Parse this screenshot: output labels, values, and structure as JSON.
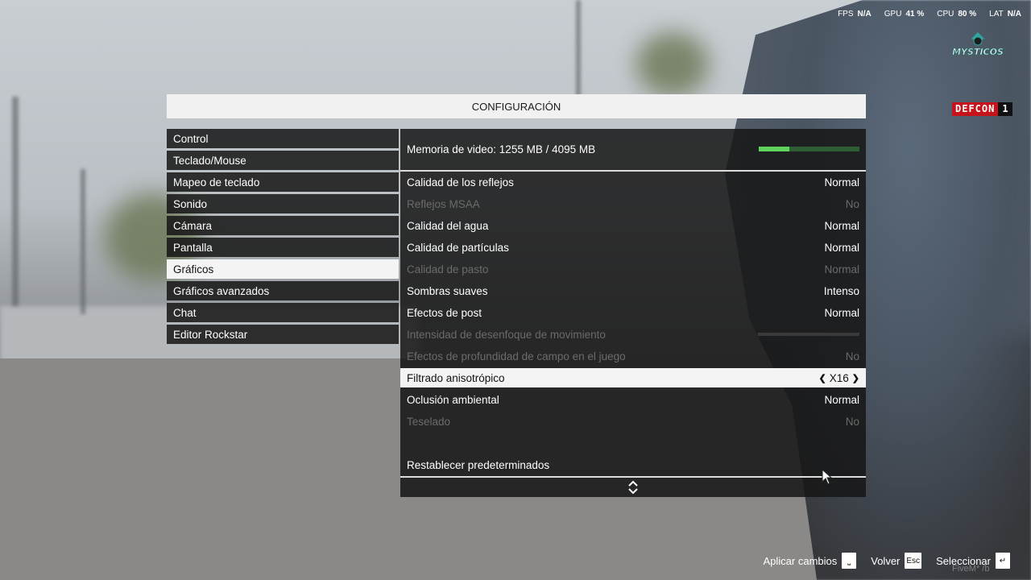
{
  "hud": {
    "fps_label": "FPS",
    "fps_value": "N/A",
    "gpu_label": "GPU",
    "gpu_value": "41 %",
    "cpu_label": "CPU",
    "cpu_value": "80 %",
    "lat_label": "LAT",
    "lat_value": "N/A"
  },
  "logo": {
    "text": "MYSTICOS"
  },
  "defcon": {
    "word": "DEFCON",
    "level": "1"
  },
  "title": "CONFIGURACIÓN",
  "menu": {
    "items": [
      {
        "label": "Control"
      },
      {
        "label": "Teclado/Mouse"
      },
      {
        "label": "Mapeo de teclado"
      },
      {
        "label": "Sonido"
      },
      {
        "label": "Cámara"
      },
      {
        "label": "Pantalla"
      },
      {
        "label": "Gráficos"
      },
      {
        "label": "Gráficos avanzados"
      },
      {
        "label": "Chat"
      },
      {
        "label": "Editor Rockstar"
      }
    ],
    "selected": "Gráficos"
  },
  "panel": {
    "vram_label": "Memoria de video: 1255 MB / 4095 MB",
    "vram_used_fraction": 0.306,
    "options": [
      {
        "label": "Calidad de los reflejos",
        "value": "Normal",
        "state": "enabled"
      },
      {
        "label": "Reflejos MSAA",
        "value": "No",
        "state": "disabled"
      },
      {
        "label": "Calidad del agua",
        "value": "Normal",
        "state": "enabled"
      },
      {
        "label": "Calidad de partículas",
        "value": "Normal",
        "state": "enabled"
      },
      {
        "label": "Calidad de pasto",
        "value": "Normal",
        "state": "disabled"
      },
      {
        "label": "Sombras suaves",
        "value": "Intenso",
        "state": "enabled"
      },
      {
        "label": "Efectos de post",
        "value": "Normal",
        "state": "enabled"
      },
      {
        "label": "Intensidad de desenfoque de movimiento",
        "value": "",
        "state": "disabled"
      },
      {
        "label": "Efectos de profundidad de campo en el juego",
        "value": "No",
        "state": "disabled"
      },
      {
        "label": "Filtrado anisotrópico",
        "value": "X16",
        "state": "selected"
      },
      {
        "label": "Oclusión ambiental",
        "value": "Normal",
        "state": "enabled"
      },
      {
        "label": "Teselado",
        "value": "No",
        "state": "disabled"
      }
    ],
    "reset_label": "Restablecer predeterminados"
  },
  "hints": {
    "apply_label": "Aplicar cambios",
    "apply_key": "⎵",
    "back_label": "Volver",
    "back_key": "Esc",
    "select_label": "Seleccionar",
    "select_key": "↵"
  },
  "footer": {
    "watermark": "FiveM* /b"
  },
  "colors": {
    "accent_green": "#5ed45f",
    "defcon_red": "#c5141b",
    "panel_bg": "#161616"
  }
}
